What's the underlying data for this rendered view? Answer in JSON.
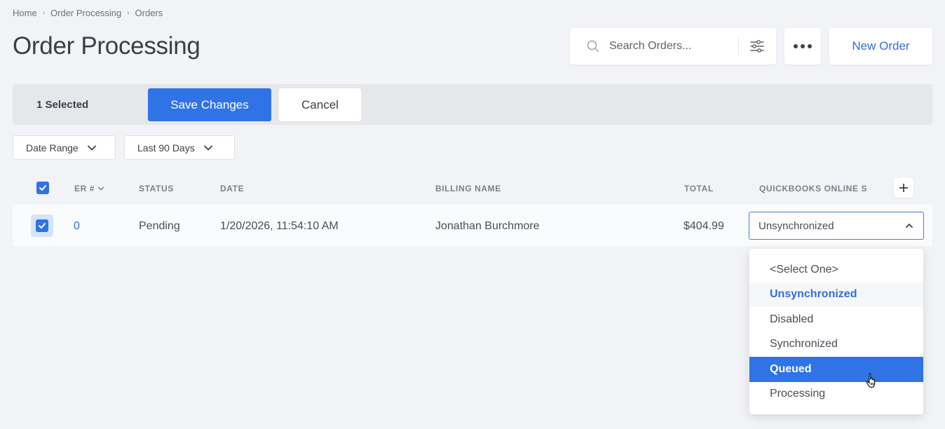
{
  "breadcrumb": {
    "items": [
      "Home",
      "Order Processing",
      "Orders"
    ],
    "separator": "›"
  },
  "page": {
    "title": "Order Processing"
  },
  "search": {
    "placeholder": "Search Orders..."
  },
  "top_actions": {
    "new_order_label": "New Order"
  },
  "selection_bar": {
    "count_label": "1 Selected",
    "save_label": "Save Changes",
    "cancel_label": "Cancel"
  },
  "filters": {
    "date_range_label": "Date Range",
    "period_label": "Last 90 Days"
  },
  "table": {
    "columns": [
      "ER #",
      "STATUS",
      "DATE",
      "BILLING NAME",
      "TOTAL",
      "QUICKBOOKS ONLINE S"
    ],
    "rows": [
      {
        "checked": true,
        "order": "0",
        "status": "Pending",
        "date": "1/20/2026, 11:54:10 AM",
        "billing_name": "Jonathan Burchmore",
        "total": "$404.99",
        "quickbooks": "Unsynchronized"
      }
    ]
  },
  "dropdown": {
    "options": [
      "<Select One>",
      "Unsynchronized",
      "Disabled",
      "Synchronized",
      "Queued",
      "Processing"
    ],
    "selected": "Unsynchronized",
    "highlighted": "Queued"
  },
  "colors": {
    "accent": "#2f73e6",
    "link": "#2f6fdd",
    "background": "#f2f3f6"
  }
}
